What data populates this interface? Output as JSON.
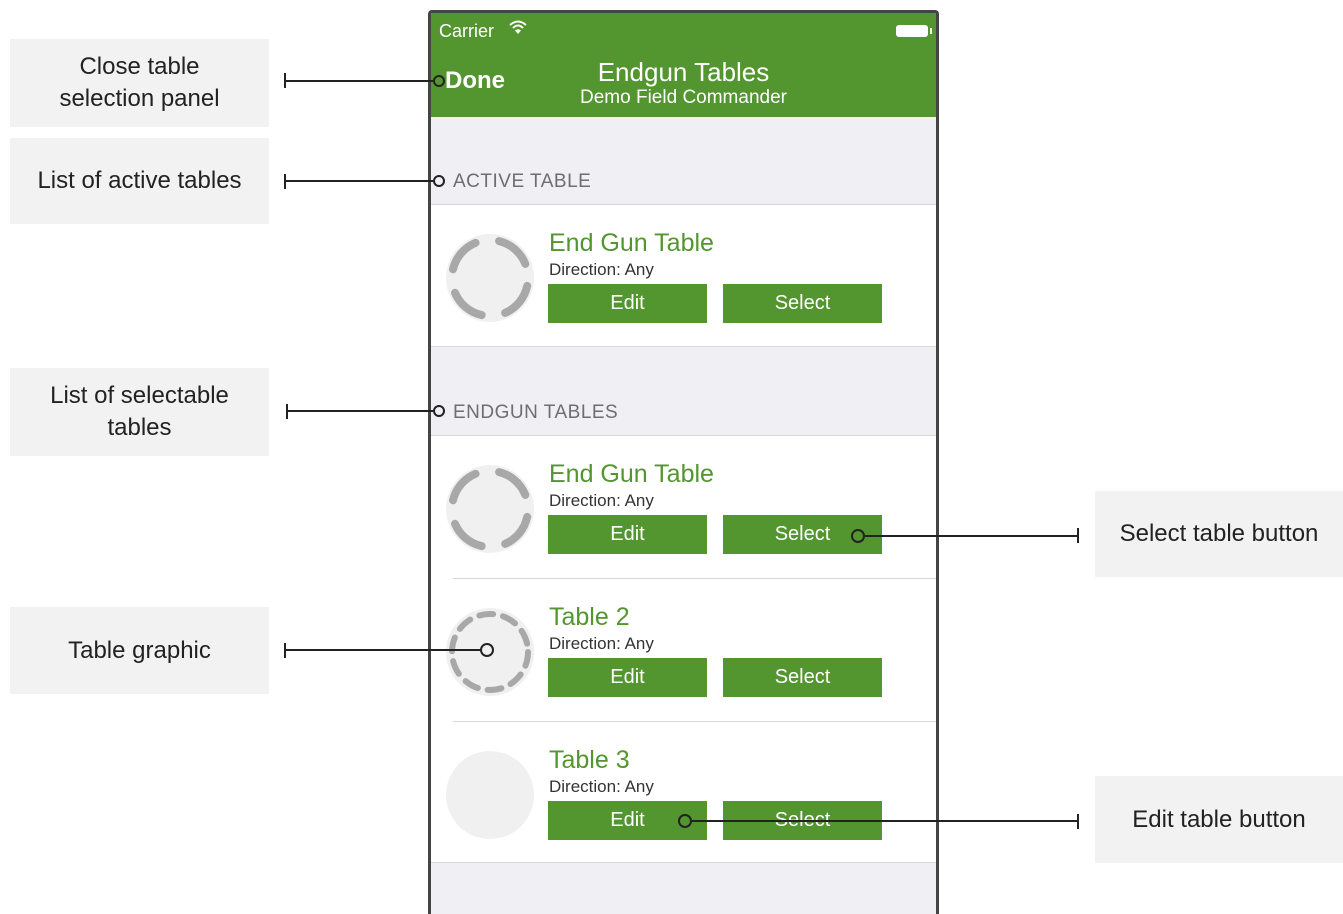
{
  "status_bar": {
    "carrier": "Carrier"
  },
  "navbar": {
    "done_label": "Done",
    "title": "Endgun Tables",
    "subtitle": "Demo Field Commander"
  },
  "sections": {
    "active_header": "ACTIVE TABLE",
    "endgun_header": "ENDGUN TABLES"
  },
  "active_table": {
    "title": "End Gun Table",
    "direction": "Direction: Any",
    "edit_label": "Edit",
    "select_label": "Select"
  },
  "endgun_tables": [
    {
      "title": "End Gun Table",
      "direction": "Direction: Any",
      "edit_label": "Edit",
      "select_label": "Select"
    },
    {
      "title": "Table 2",
      "direction": "Direction: Any",
      "edit_label": "Edit",
      "select_label": "Select"
    },
    {
      "title": "Table 3",
      "direction": "Direction: Any",
      "edit_label": "Edit",
      "select_label": "Select"
    }
  ],
  "callouts": {
    "close_panel": [
      "Close table",
      "selection panel"
    ],
    "active_list": "List of active tables",
    "selectable_list": [
      "List of selectable",
      "tables"
    ],
    "table_graphic": "Table graphic",
    "select_button": "Select table button",
    "edit_button": "Edit table button"
  },
  "colors": {
    "accent": "#53952f",
    "background": "#efeff4",
    "callout_bg": "#f2f2f2"
  },
  "icons": {
    "wifi": "wifi-icon",
    "battery": "battery-icon",
    "table_graphic": "ring-icon"
  }
}
